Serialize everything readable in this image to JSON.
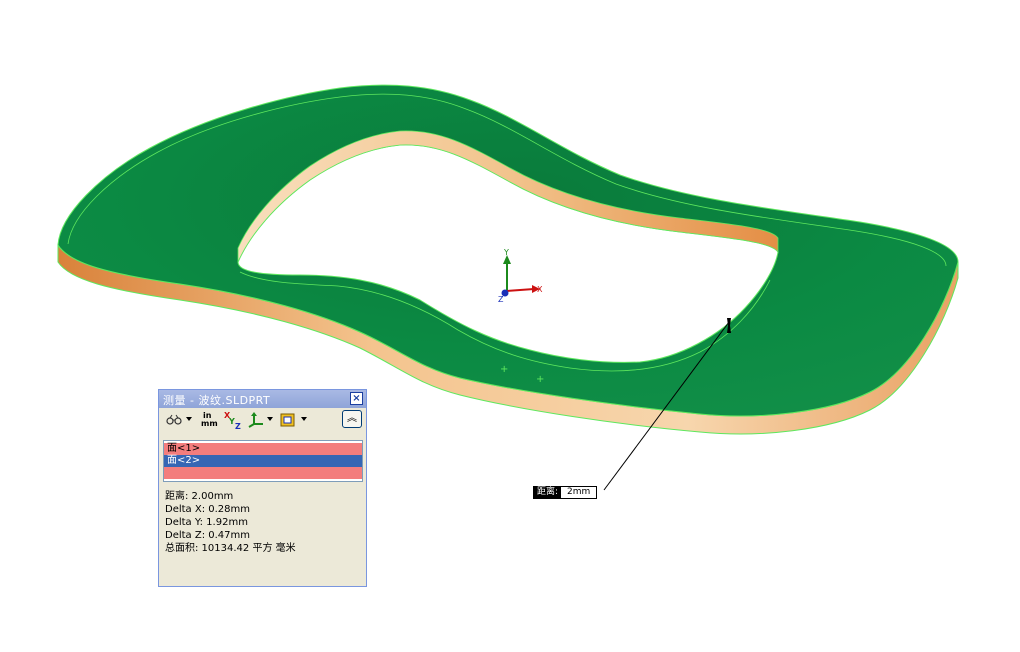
{
  "dialog": {
    "title": "测量 - 波纹.SLDPRT",
    "close_glyph": "×",
    "toolbar": {
      "units_top": "in",
      "units_bottom": "mm",
      "collapse_glyph": "︽"
    },
    "selections": [
      "面<1>",
      "面<2>"
    ],
    "results": [
      "距离: 2.00mm",
      "Delta X: 0.28mm",
      "Delta Y: 1.92mm",
      "Delta Z: 0.47mm",
      "总面积: 10134.42 平方 毫米"
    ]
  },
  "callout": {
    "label": "距离:",
    "value": "2mm"
  },
  "triad": {
    "x": "X",
    "y": "Y",
    "z": "Z"
  },
  "colors": {
    "face_green": "#08803e",
    "edge_orange": "#e89a50",
    "highlight_edge": "#5ee85e",
    "selection_pink": "#f37d7d",
    "selection_blue": "#3666b4"
  }
}
